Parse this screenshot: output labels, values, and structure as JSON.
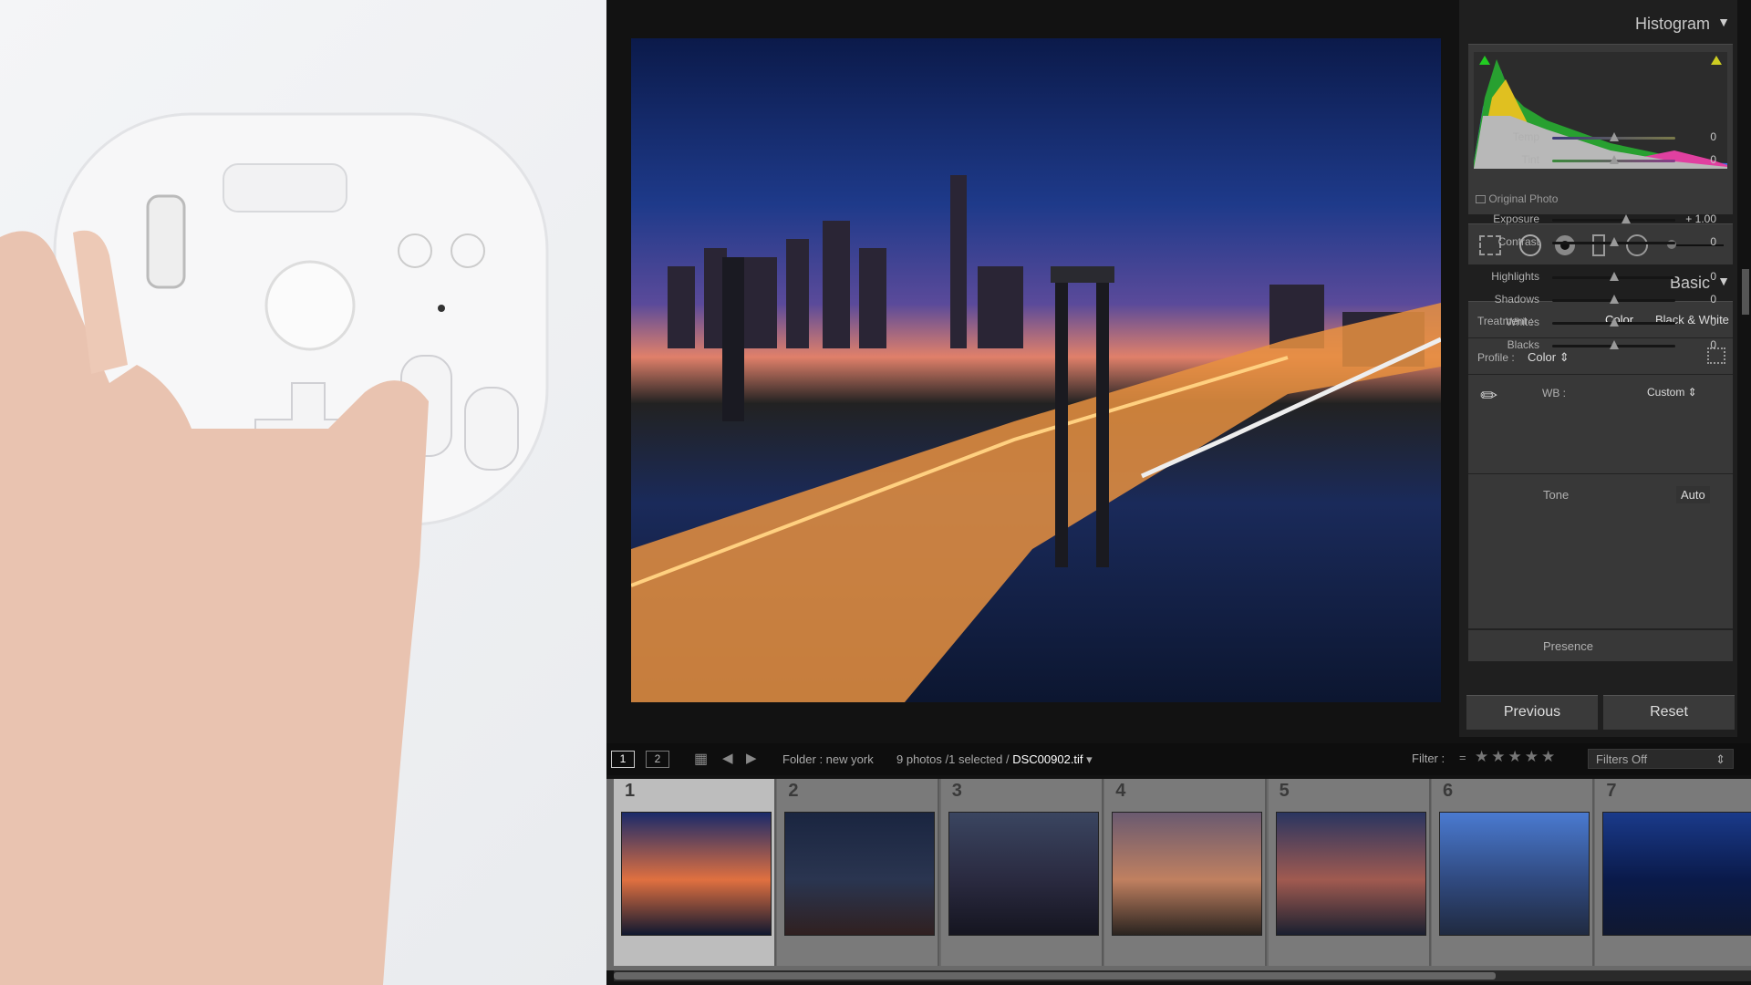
{
  "histogram": {
    "title": "Histogram",
    "original_photo_label": "Original Photo"
  },
  "basic": {
    "title": "Basic",
    "treatment_label": "Treatment :",
    "treatment_options": [
      "Color",
      "Black & White"
    ],
    "profile_label": "Profile :",
    "profile_value": "Color",
    "wb_label": "WB :",
    "wb_value": "Custom",
    "tone_label": "Tone",
    "auto_label": "Auto",
    "sliders": [
      {
        "label": "Temp",
        "value": "0",
        "level": 0.5
      },
      {
        "label": "Tint",
        "value": "0",
        "level": 0.5
      },
      {
        "label": "Exposure",
        "value": "+ 1.00",
        "level": 0.6
      },
      {
        "label": "Contrast",
        "value": "0",
        "level": 0.5
      },
      {
        "label": "Highlights",
        "value": "0",
        "level": 0.5
      },
      {
        "label": "Shadows",
        "value": "0",
        "level": 0.5
      },
      {
        "label": "Whites",
        "value": "0",
        "level": 0.5
      },
      {
        "label": "Blacks",
        "value": "0",
        "level": 0.5
      }
    ],
    "presence_label": "Presence"
  },
  "buttons": {
    "previous": "Previous",
    "reset": "Reset"
  },
  "toolbar": {
    "view1": "1",
    "view2": "2",
    "folder": "Folder : new york",
    "count": "9 photos /1 selected /",
    "filename": "DSC00902.tif",
    "filter_label": "Filter :",
    "filter_eq": "=",
    "filters_value": "Filters Off"
  },
  "filmstrip": [
    {
      "num": "1",
      "colors": [
        "#1a2a6a",
        "#e07040",
        "#101830"
      ]
    },
    {
      "num": "2",
      "colors": [
        "#1a2540",
        "#2a3550",
        "#302020"
      ]
    },
    {
      "num": "3",
      "colors": [
        "#3a4560",
        "#2a2a40",
        "#151520"
      ]
    },
    {
      "num": "4",
      "colors": [
        "#6a5a70",
        "#c08060",
        "#2a2420"
      ]
    },
    {
      "num": "5",
      "colors": [
        "#2a3560",
        "#a05a50",
        "#1a2030"
      ]
    },
    {
      "num": "6",
      "colors": [
        "#4a7ad0",
        "#304a80",
        "#202a40"
      ]
    },
    {
      "num": "7",
      "colors": [
        "#1a3a8a",
        "#0a1a4a",
        "#101830"
      ]
    }
  ]
}
